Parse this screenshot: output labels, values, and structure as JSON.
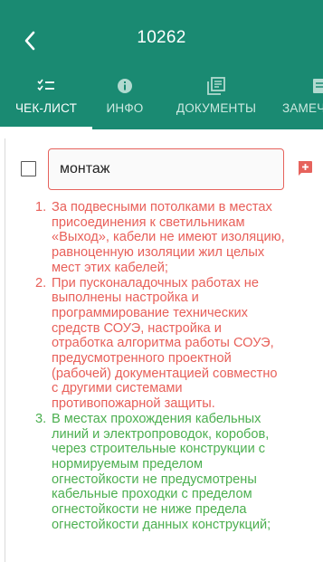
{
  "header": {
    "title": "10262",
    "background": "#1a8a72"
  },
  "tabs": [
    {
      "label": "ЧЕК-ЛИСТ",
      "icon": "checklist-icon",
      "active": true
    },
    {
      "label": "ИНФО",
      "icon": "info-icon",
      "active": false
    },
    {
      "label": "ДОКУМЕНТЫ",
      "icon": "documents-icon",
      "active": false
    },
    {
      "label": "ЗАМЕЧ",
      "icon": "remarks-icon",
      "active": false
    }
  ],
  "item": {
    "checked": false,
    "input_value": "монтаж",
    "input_border_color": "#e6625c",
    "add_icon": "add-comment-icon"
  },
  "remarks": [
    {
      "num": "1.",
      "color": "red",
      "text": "За подвесными потолками в местах\nприсоединения к светильникам\n«Выход», кабели не имеют изоляцию,\nравноценную изоляции жил целых\nмест этих кабелей;"
    },
    {
      "num": "2.",
      "color": "red",
      "text": "При пусконаладочных работах не\nвыполнены настройка и\nпрограммирование технических\nсредств СОУЭ, настройка и\nотработка алгоритма работы СОУЭ,\nпредусмотренного проектной\n(рабочей) документацией совместно\nс другими системами\nпротивопожарной защиты."
    },
    {
      "num": "3.",
      "color": "green",
      "text": "В местах прохождения кабельных\nлиний и электропроводок, коробов,\nчерез строительные конструкции с\nнормируемым пределом\nогнестойкости не предусмотрены\nкабельные проходки с пределом\nогнестойкости не ниже предела\nогнестойкости данных конструкций;"
    }
  ],
  "colors": {
    "red": "#e8605a",
    "green": "#4caf50"
  }
}
